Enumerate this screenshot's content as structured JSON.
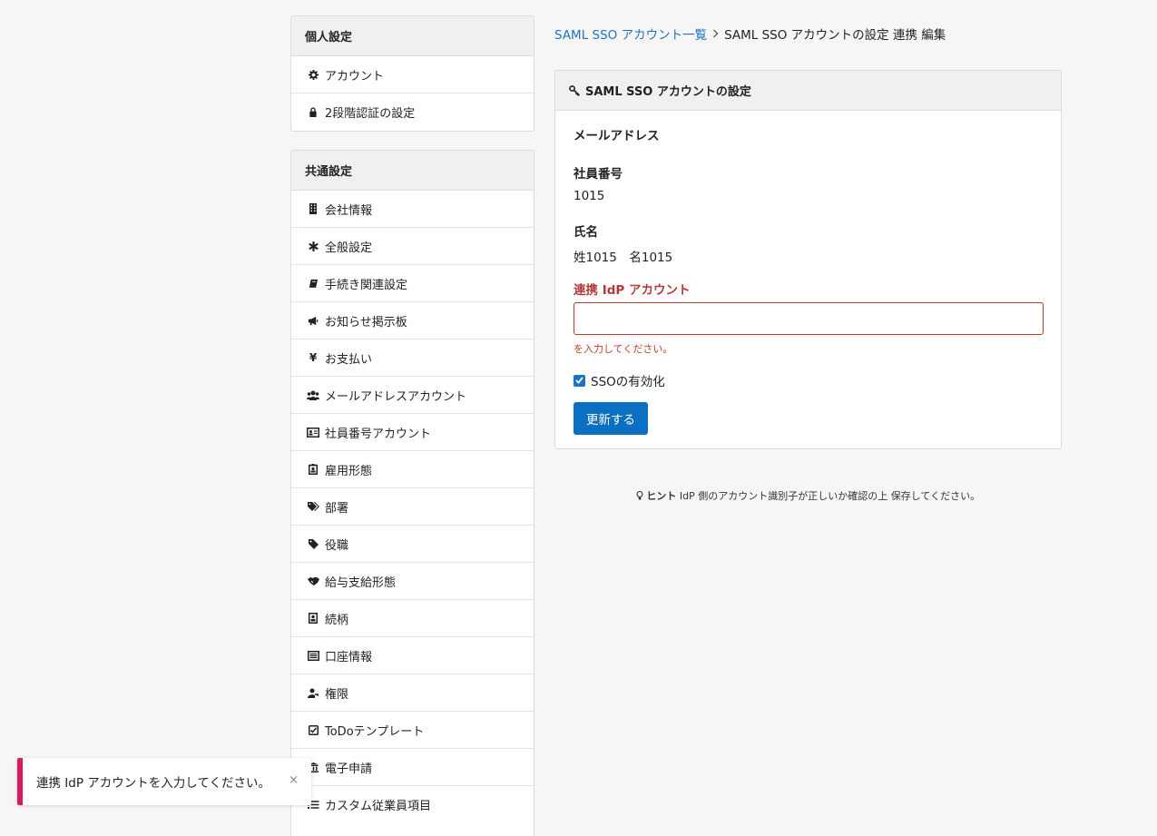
{
  "sidebar": {
    "personal": {
      "title": "個人設定",
      "items": [
        {
          "label": "アカウント",
          "icon": "gear-icon"
        },
        {
          "label": "2段階認証の設定",
          "icon": "lock-icon"
        }
      ]
    },
    "common": {
      "title": "共通設定",
      "items": [
        {
          "label": "会社情報",
          "icon": "building-icon"
        },
        {
          "label": "全般設定",
          "icon": "asterisk-icon"
        },
        {
          "label": "手続き関連設定",
          "icon": "book-icon"
        },
        {
          "label": "お知らせ掲示板",
          "icon": "megaphone-icon"
        },
        {
          "label": "お支払い",
          "icon": "yen-icon"
        },
        {
          "label": "メールアドレスアカウント",
          "icon": "users-icon"
        },
        {
          "label": "社員番号アカウント",
          "icon": "id-card-icon"
        },
        {
          "label": "雇用形態",
          "icon": "badge-icon"
        },
        {
          "label": "部署",
          "icon": "tags-icon"
        },
        {
          "label": "役職",
          "icon": "tag-icon"
        },
        {
          "label": "給与支給形態",
          "icon": "handshake-icon"
        },
        {
          "label": "続柄",
          "icon": "contact-icon"
        },
        {
          "label": "口座情報",
          "icon": "list-alt-icon"
        },
        {
          "label": "権限",
          "icon": "user-key-icon"
        },
        {
          "label": "ToDoテンプレート",
          "icon": "check-square-icon"
        },
        {
          "label": "電子申請",
          "icon": "bank-icon"
        },
        {
          "label": "カスタム従業員項目",
          "icon": "list-icon"
        }
      ]
    }
  },
  "breadcrumb": {
    "link": "SAML SSO アカウント一覧",
    "current": "SAML SSO アカウントの設定 連携 編集"
  },
  "card": {
    "title": "SAML SSO アカウントの設定",
    "email_label": "メールアドレス",
    "employee_no_label": "社員番号",
    "employee_no_value": "1015",
    "name_label": "氏名",
    "name_value": "姓1015　名1015",
    "idp_label": "連携 IdP アカウント",
    "idp_value": "",
    "idp_error": "を入力してください。",
    "sso_label": "SSOの有効化",
    "sso_checked": true,
    "submit_label": "更新する"
  },
  "hint": {
    "prefix": "ヒント",
    "text": " IdP 側のアカウント識別子が正しいか確認の上 保存してください。"
  },
  "toast": {
    "message": "連携 IdP アカウントを入力してください。",
    "close": "×"
  },
  "colors": {
    "link": "#1a73c8",
    "primary_button": "#0b6fc2",
    "error": "#c0392b",
    "toast_accent": "#d81b60"
  }
}
